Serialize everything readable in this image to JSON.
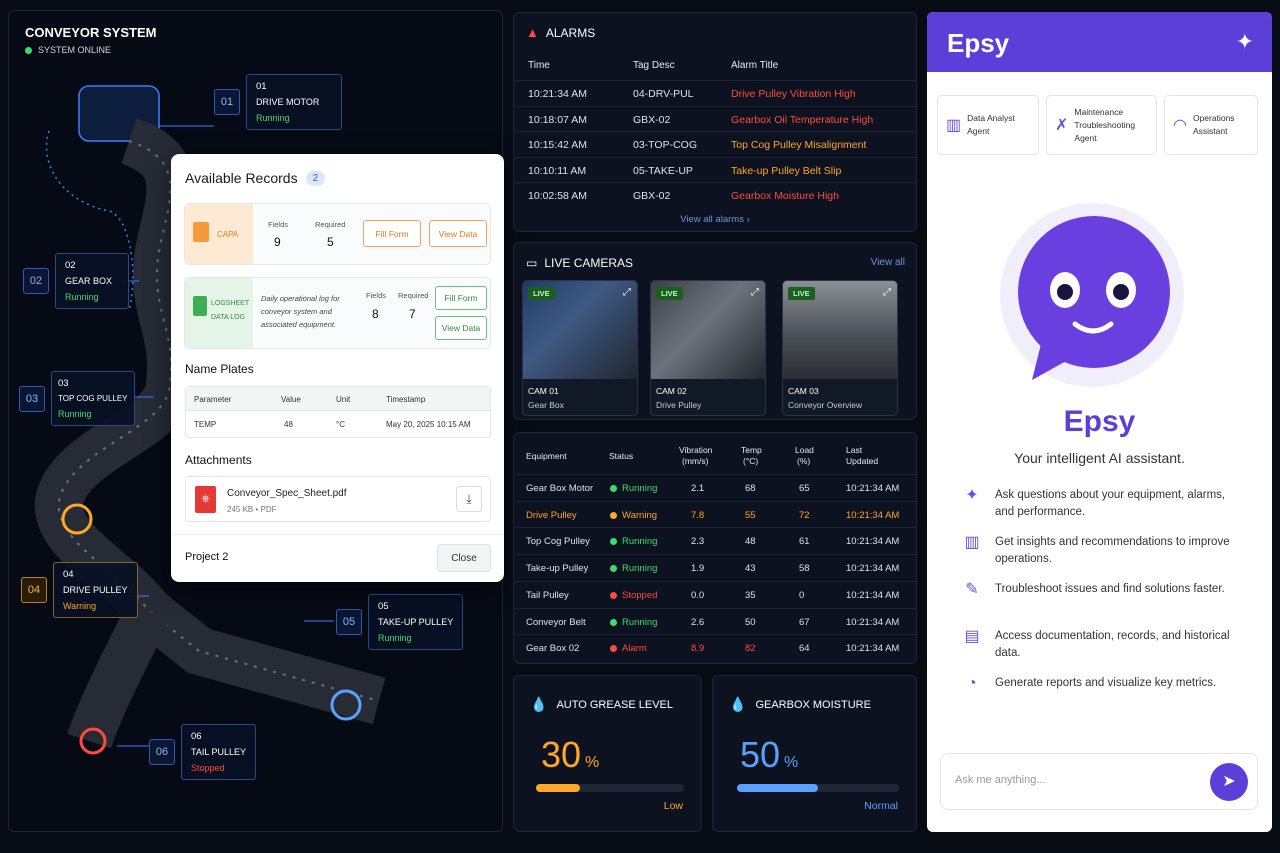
{
  "conveyor": {
    "title": "CONVEYOR SYSTEM",
    "status": "SYSTEM ONLINE",
    "nodes": [
      {
        "num": "01",
        "code": "01",
        "name": "DRIVE MOTOR",
        "status": "Running"
      },
      {
        "num": "02",
        "code": "02",
        "name": "GEAR BOX",
        "status": "Running"
      },
      {
        "num": "03",
        "code": "03",
        "name": "TOP COG PULLEY",
        "status": "Running"
      },
      {
        "num": "04",
        "code": "04",
        "name": "DRIVE PULLEY",
        "status": "Warning"
      },
      {
        "num": "05",
        "code": "05",
        "name": "TAKE-UP PULLEY",
        "status": "Running"
      },
      {
        "num": "06",
        "code": "06",
        "name": "TAIL PULLEY",
        "status": "Stopped"
      }
    ]
  },
  "records": {
    "title": "Available Records",
    "count": "2",
    "capa": {
      "label": "CAPA",
      "fields_label": "Fields",
      "fields": "9",
      "required_label": "Required",
      "required": "5",
      "fill": "Fill Form",
      "view": "View Data"
    },
    "logsheet": {
      "label1": "LOGSHEET",
      "label2": "DATA LOG",
      "desc": "Daily operational log for conveyor system and associated equipment.",
      "fields_label": "Fields",
      "fields": "8",
      "required_label": "Required",
      "required": "7",
      "fill": "Fill Form",
      "view": "View Data"
    },
    "nameplates": {
      "title": "Name Plates",
      "headers": [
        "Parameter",
        "Value",
        "Unit",
        "Timestamp"
      ],
      "row": [
        "TEMP",
        "48",
        "°C",
        "May 20, 2025 10:15 AM"
      ]
    },
    "attachments": {
      "title": "Attachments",
      "file": "Conveyor_Spec_Sheet.pdf",
      "meta": "245 KB • PDF"
    },
    "project": "Project 2",
    "close": "Close"
  },
  "alarms": {
    "title": "ALARMS",
    "headers": [
      "Time",
      "Tag Desc",
      "Alarm Title"
    ],
    "rows": [
      {
        "time": "10:21:34 AM",
        "tag": "04-DRV-PUL",
        "title": "Drive Pulley Vibration High",
        "color": "#ff4a3d"
      },
      {
        "time": "10:18:07 AM",
        "tag": "GBX-02",
        "title": "Gearbox Oil Temperature High",
        "color": "#ff4a3d"
      },
      {
        "time": "10:15:42 AM",
        "tag": "03-TOP-COG",
        "title": "Top Cog Pulley Misalignment",
        "color": "#ffa726"
      },
      {
        "time": "10:10:11 AM",
        "tag": "05-TAKE-UP",
        "title": "Take-up Pulley Belt Slip",
        "color": "#ffa726"
      },
      {
        "time": "10:02:58 AM",
        "tag": "GBX-02",
        "title": "Gearbox Moisture High",
        "color": "#ff4a3d"
      }
    ],
    "view_all": "View all alarms"
  },
  "cameras": {
    "title": "LIVE CAMERAS",
    "view_all": "View all",
    "live": "LIVE",
    "items": [
      {
        "name": "CAM 01",
        "desc": "Gear Box"
      },
      {
        "name": "CAM 02",
        "desc": "Drive Pulley"
      },
      {
        "name": "CAM 03",
        "desc": "Conveyor Overview"
      }
    ]
  },
  "equipment": {
    "headers": [
      "Equipment",
      "Status",
      "Vibration",
      "(mm/s)",
      "Temp",
      "(°C)",
      "Load",
      "(%)",
      "Last",
      "Updated"
    ],
    "rows": [
      {
        "name": "Gear Box Motor",
        "status": "Running",
        "vib": "2.1",
        "temp": "68",
        "load": "65",
        "time": "10:21:34 AM",
        "state": "ok"
      },
      {
        "name": "Drive Pulley",
        "status": "Warning",
        "vib": "7.8",
        "temp": "55",
        "load": "72",
        "time": "10:21:34 AM",
        "state": "warn"
      },
      {
        "name": "Top Cog Pulley",
        "status": "Running",
        "vib": "2.3",
        "temp": "48",
        "load": "61",
        "time": "10:21:34 AM",
        "state": "ok"
      },
      {
        "name": "Take-up Pulley",
        "status": "Running",
        "vib": "1.9",
        "temp": "43",
        "load": "58",
        "time": "10:21:34 AM",
        "state": "ok"
      },
      {
        "name": "Tail Pulley",
        "status": "Stopped",
        "vib": "0.0",
        "temp": "35",
        "load": "0",
        "time": "10:21:34 AM",
        "state": "stop"
      },
      {
        "name": "Conveyor Belt",
        "status": "Running",
        "vib": "2.6",
        "temp": "50",
        "load": "67",
        "time": "10:21:34 AM",
        "state": "ok"
      },
      {
        "name": "Gear Box 02",
        "status": "Alarm",
        "vib": "8.9",
        "temp": "82",
        "load": "64",
        "time": "10:21:34 AM",
        "state": "alarm"
      }
    ]
  },
  "grease": {
    "title": "AUTO GREASE LEVEL",
    "value": "30",
    "unit": "%",
    "level": 0.3,
    "status": "Low"
  },
  "moisture": {
    "title": "GEARBOX MOISTURE",
    "value": "50",
    "unit": "%",
    "level": 0.5,
    "status": "Normal"
  },
  "epsy": {
    "header": "Epsy",
    "agents": [
      [
        "Data Analyst",
        "Agent"
      ],
      [
        "Maintenance",
        "Troubleshooting",
        "Agent"
      ],
      [
        "Operations",
        "Assistant"
      ]
    ],
    "name": "Epsy",
    "tagline": "Your intelligent AI assistant.",
    "features": [
      "Ask questions about your equipment, alarms, and performance.",
      "Get insights and recommendations to improve operations.",
      "Troubleshoot issues and find solutions faster.",
      "Access documentation, records, and historical data.",
      "Generate reports and visualize key metrics."
    ],
    "input_placeholder": "Ask me anything..."
  },
  "colors": {
    "ok": "#3ddc6e",
    "warn": "#ffa726",
    "stop": "#ff4a3d",
    "accent": "#5b3fd8"
  }
}
